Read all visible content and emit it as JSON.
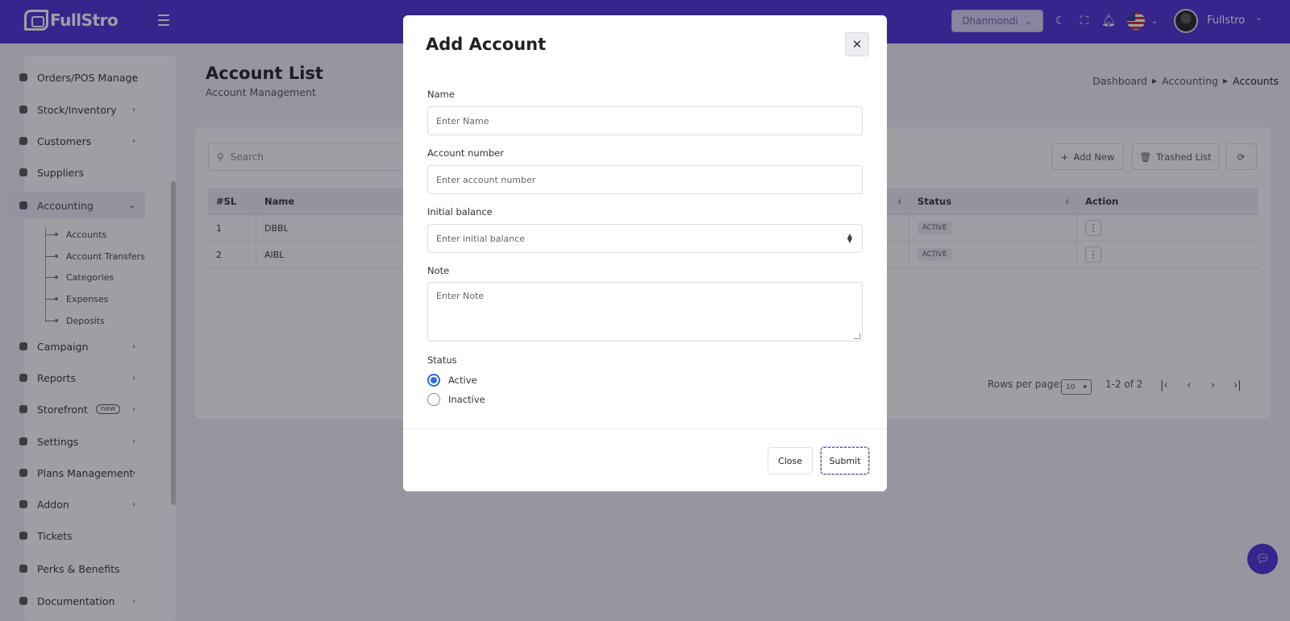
{
  "app": {
    "brand": "FullStro",
    "branch": "Dhanmondi",
    "user_name": "Fullstro"
  },
  "sidebar": {
    "items": [
      {
        "label": "Orders/POS Manage"
      },
      {
        "label": "Stock/Inventory"
      },
      {
        "label": "Customers"
      },
      {
        "label": "Suppliers"
      },
      {
        "label": "Accounting"
      },
      {
        "label": "Campaign"
      },
      {
        "label": "Reports"
      },
      {
        "label": "Storefront",
        "badge": "new"
      },
      {
        "label": "Settings"
      },
      {
        "label": "Plans Management"
      },
      {
        "label": "Addon"
      },
      {
        "label": "Tickets"
      },
      {
        "label": "Perks & Benefits"
      },
      {
        "label": "Documentation"
      }
    ],
    "accounting_sub": [
      {
        "label": "Accounts"
      },
      {
        "label": "Account Transfers"
      },
      {
        "label": "Categories"
      },
      {
        "label": "Expenses"
      },
      {
        "label": "Deposits"
      }
    ]
  },
  "page": {
    "title": "Account List",
    "subtitle": "Account Management",
    "breadcrumb": [
      "Dashboard",
      "Accounting",
      "Accounts"
    ]
  },
  "toolbar": {
    "search_placeholder": "Search",
    "add_new": "Add New",
    "trashed_list": "Trashed List"
  },
  "table": {
    "headers": [
      "#SL",
      "Name",
      "Status",
      "Action"
    ],
    "rows": [
      {
        "sl": "1",
        "name": "DBBL",
        "status": "ACTIVE"
      },
      {
        "sl": "2",
        "name": "AIBL",
        "status": "ACTIVE"
      }
    ]
  },
  "pagination": {
    "rows_per_page_label": "Rows per page:",
    "rows_per_page": "10",
    "range": "1-2 of 2"
  },
  "modal": {
    "title": "Add Account",
    "name_label": "Name",
    "name_placeholder": "Enter Name",
    "account_number_label": "Account number",
    "account_number_placeholder": "Enter account number",
    "initial_balance_label": "Initial balance",
    "initial_balance_placeholder": "Enter initial balance",
    "note_label": "Note",
    "note_placeholder": "Enter Note",
    "status_label": "Status",
    "status_options": [
      "Active",
      "Inactive"
    ],
    "status_selected": "Active",
    "close_label": "Close",
    "submit_label": "Submit"
  },
  "colors": {
    "brand": "#4a2fd6",
    "radio_accent": "#2e6ad9"
  }
}
